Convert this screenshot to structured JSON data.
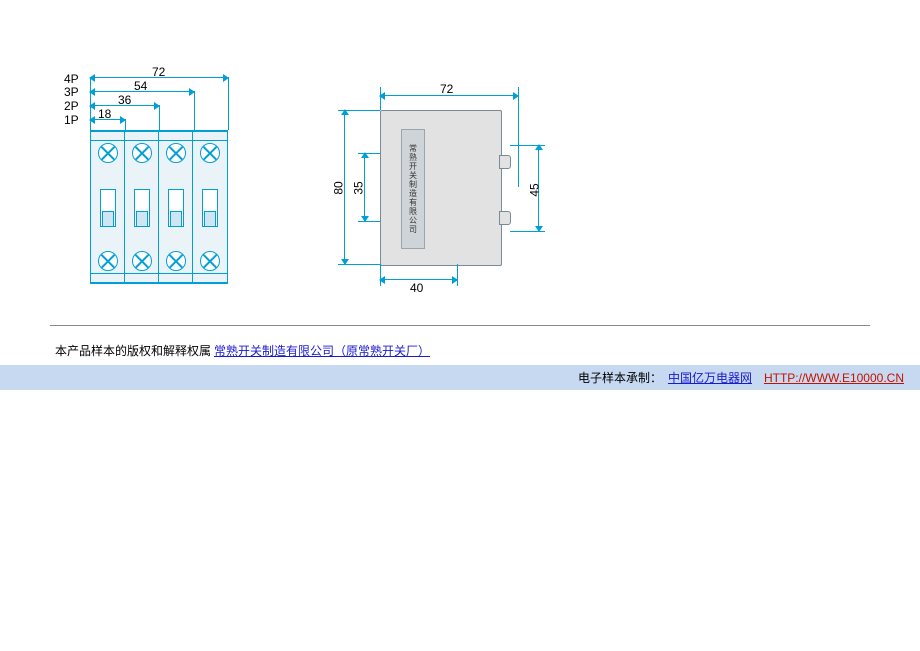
{
  "front_view": {
    "pole_labels": [
      "4P",
      "3P",
      "2P",
      "1P"
    ],
    "dims": {
      "w_4p": "72",
      "w_3p": "54",
      "w_2p": "36",
      "w_1p": "18"
    }
  },
  "side_view": {
    "top_width": "72",
    "height_outer": "80",
    "height_inner": "35",
    "right_height": "45",
    "bottom_width": "40",
    "maker_text": "常熟开关制造有限公司"
  },
  "copyright": {
    "prefix": "本产品样本的版权和解释权属  ",
    "company": "常熟开关制造有限公司（原常熟开关厂）"
  },
  "footer": {
    "prefix": "电子样本承制：",
    "site_name": "中国亿万电器网",
    "site_url": "HTTP://WWW.E10000.CN"
  }
}
